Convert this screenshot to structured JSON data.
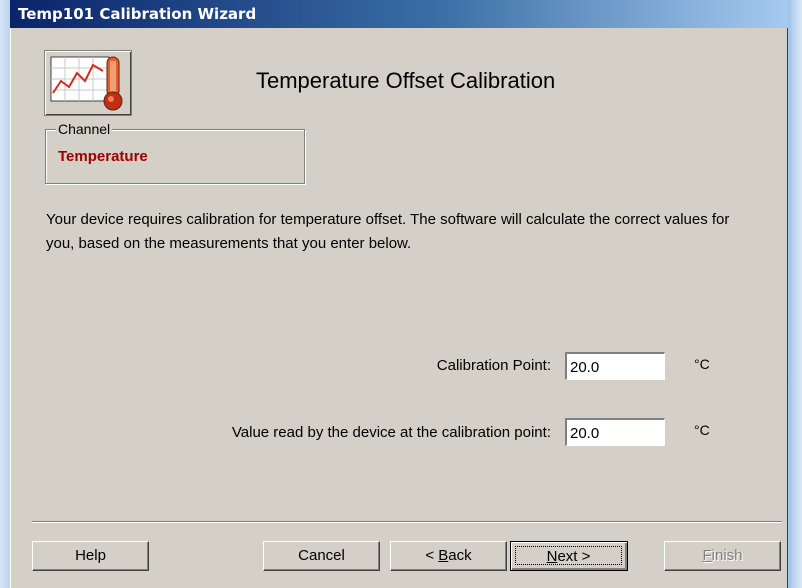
{
  "window": {
    "title": "Temp101 Calibration Wizard"
  },
  "header": {
    "heading": "Temperature Offset Calibration",
    "logo_icon": "temperature-graph-thermometer-icon"
  },
  "channel": {
    "legend": "Channel",
    "value": "Temperature",
    "value_color": "#a00000"
  },
  "description": "Your device requires calibration for temperature offset. The software will calculate the correct values for you, based on the measurements that you enter below.",
  "fields": {
    "calibration_point": {
      "label": "Calibration Point:",
      "value": "20.0",
      "unit": "°C"
    },
    "device_value": {
      "label": "Value read by the device at the calibration point:",
      "value": "20.0",
      "unit": "°C"
    }
  },
  "buttons": {
    "help": "Help",
    "cancel": "Cancel",
    "back": {
      "prefix": "< ",
      "mnemonic": "B",
      "rest": "ack"
    },
    "next": {
      "mnemonic": "N",
      "rest": "ext >"
    },
    "finish": {
      "mnemonic": "F",
      "rest": "inish"
    }
  }
}
